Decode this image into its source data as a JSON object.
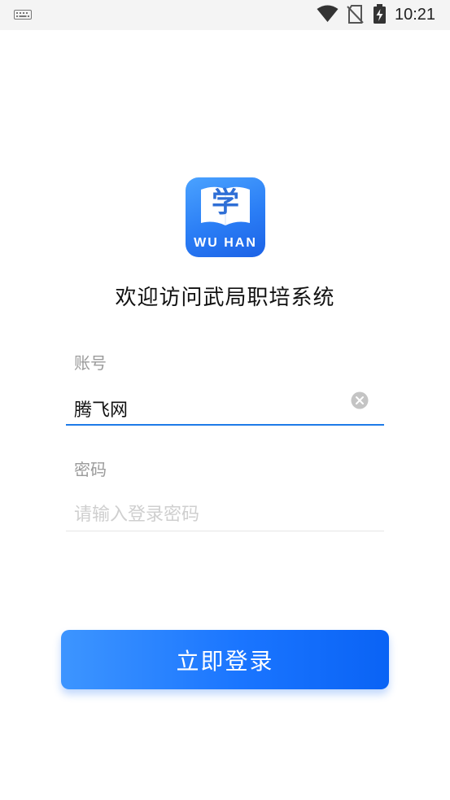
{
  "status_bar": {
    "time": "10:21",
    "icons": [
      "keyboard-icon",
      "wifi-icon",
      "no-sim-icon",
      "battery-charging-icon"
    ]
  },
  "logo": {
    "glyph": "学",
    "caption": "WU HAN",
    "colors": {
      "gradient_start": "#4aa2ff",
      "gradient_end": "#1c62e6"
    }
  },
  "welcome_title": "欢迎访问武局职培系统",
  "form": {
    "account_label": "账号",
    "account_value": "腾飞网",
    "password_label": "密码",
    "password_placeholder": "请输入登录密码"
  },
  "login_button_label": "立即登录",
  "colors": {
    "accent": "#1a75ff",
    "active_underline": "#1e7be8",
    "inactive_underline": "#e6e6e6",
    "label_gray": "#9b9b9b"
  }
}
